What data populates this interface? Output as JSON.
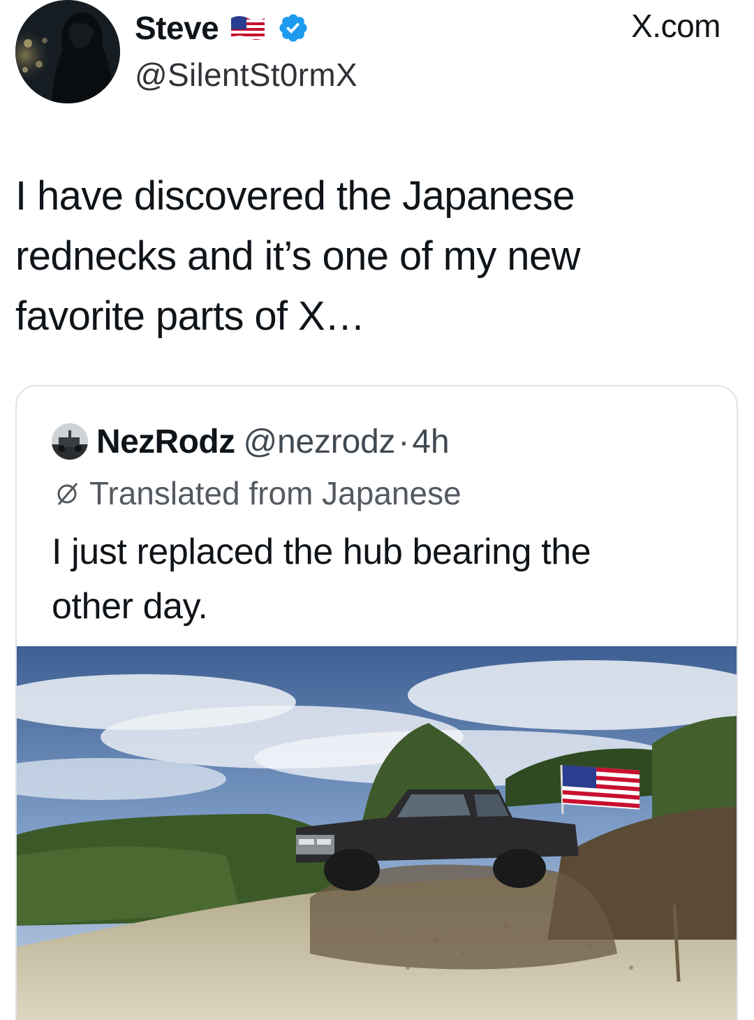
{
  "author": {
    "display_name": "Steve",
    "handle": "@SilentSt0rmX",
    "flag_icon": "us-flag-emoji",
    "verified_icon": "verified-badge-icon",
    "verified_color": "#1d9bf0"
  },
  "site_label": "X.com",
  "tweet": {
    "text_lines": [
      "I have discovered the Japanese",
      "rednecks and it’s one of my new",
      "favorite parts of X…"
    ]
  },
  "quoted": {
    "display_name": "NezRodz",
    "handle": "@nezrodz",
    "separator": "·",
    "time": "4h",
    "translated_label": "Translated from Japanese",
    "translate_icon": "translate-icon",
    "text_lines": [
      "I just replaced the hub bearing the",
      "other day."
    ],
    "media": {
      "icon": "video-thumbnail",
      "alt": ""
    }
  },
  "colors": {
    "text_primary": "#0f1419",
    "text_secondary": "#53595f",
    "card_border": "#dfe3e6",
    "verified": "#1d9bf0"
  }
}
